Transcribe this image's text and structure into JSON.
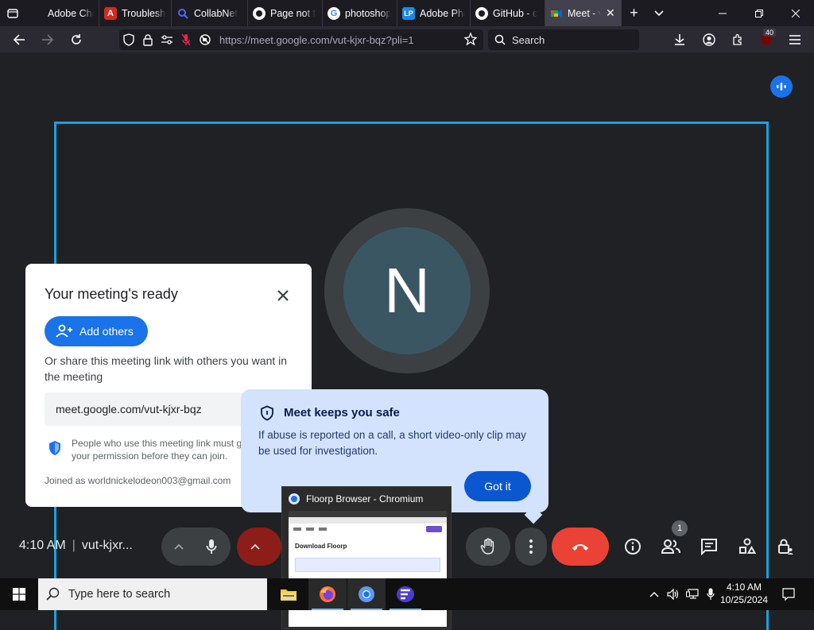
{
  "browser": {
    "tabs": [
      {
        "title": "Adobe Checko",
        "favicon": "firefox-view-icon"
      },
      {
        "title": "Troublesho",
        "favicon": "adobe-icon"
      },
      {
        "title": "CollabNet",
        "favicon": "search-icon"
      },
      {
        "title": "Page not f",
        "favicon": "github-icon"
      },
      {
        "title": "photoshop",
        "favicon": "google-icon"
      },
      {
        "title": "Adobe Pho",
        "favicon": "lp-icon"
      },
      {
        "title": "GitHub - c",
        "favicon": "github-icon"
      },
      {
        "title": "Meet - v",
        "favicon": "meet-icon",
        "active": true
      }
    ],
    "url": "https://meet.google.com/vut-kjxr-bqz?pli=1",
    "search_placeholder": "Search",
    "extension_badge": "40"
  },
  "meet": {
    "participant_initial": "N",
    "ready_card": {
      "title": "Your meeting's ready",
      "add_others_label": "Add others",
      "share_text": "Or share this meeting link with others you want in the meeting",
      "meeting_link": "meet.google.com/vut-kjxr-bqz",
      "permission_text": "People who use this meeting link must get your permission before they can join.",
      "joined_as": "Joined as worldnickelodeon003@gmail.com"
    },
    "safe_card": {
      "title": "Meet keeps you safe",
      "body": "If abuse is reported on a call, a short video-only clip may be used for investigation.",
      "got_it_label": "Got it"
    },
    "bottom_bar": {
      "time": "4:10 AM",
      "separator": "|",
      "meeting_code": "vut-kjxr...",
      "people_count": "1"
    }
  },
  "thumbnail": {
    "title": "Floorp Browser - Chromium",
    "page_heading": "Download Floorp"
  },
  "taskbar": {
    "search_placeholder": "Type here to search",
    "time": "4:10 AM",
    "date": "10/25/2024"
  },
  "colors": {
    "accent": "#1a73e8",
    "share_border": "#1aa1e0",
    "end_call": "#ea4335",
    "safe_bg": "#d3e3fd"
  }
}
